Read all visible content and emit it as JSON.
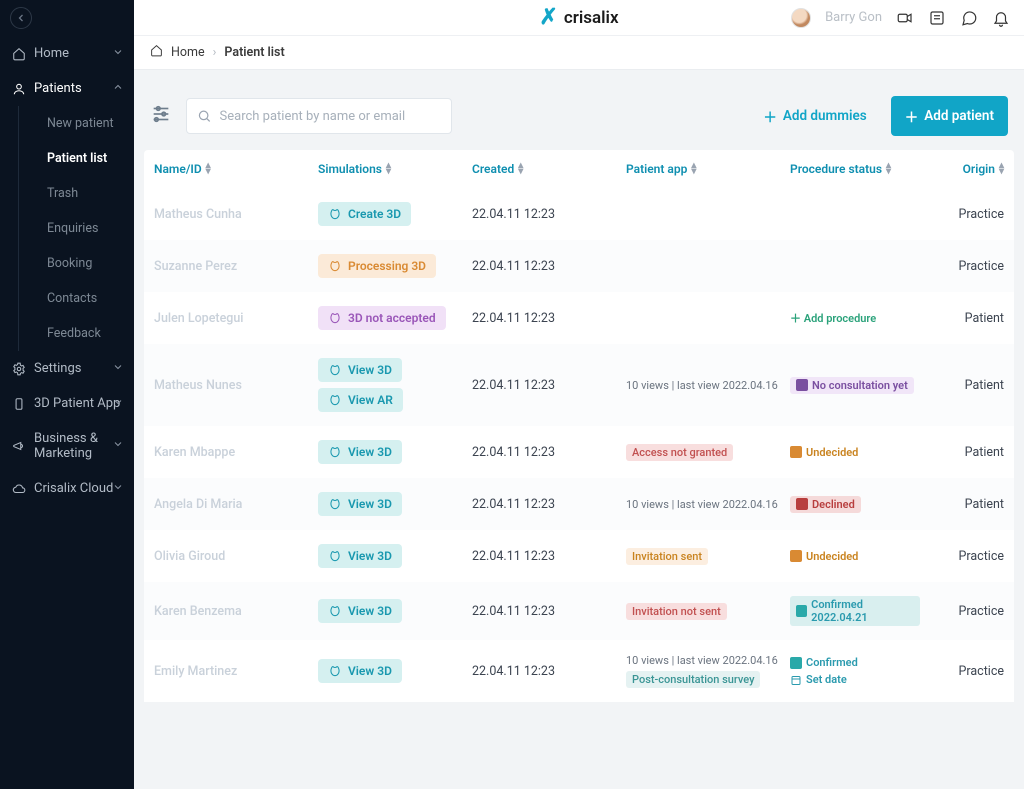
{
  "brand": "crisalix",
  "user": {
    "name": "Barry Gon"
  },
  "breadcrumb": {
    "home": "Home",
    "current": "Patient list"
  },
  "sidebar": {
    "home": "Home",
    "patients": "Patients",
    "sub": {
      "new_patient": "New patient",
      "patient_list": "Patient list",
      "trash": "Trash",
      "enquiries": "Enquiries",
      "booking": "Booking",
      "contacts": "Contacts",
      "feedback": "Feedback"
    },
    "settings": "Settings",
    "app3d": "3D Patient App",
    "business": "Business & Marketing",
    "cloud": "Crisalix Cloud"
  },
  "toolbar": {
    "search_placeholder": "Search patient by name or email",
    "add_dummies": "Add dummies",
    "add_patient": "Add patient"
  },
  "columns": {
    "name": "Name/ID",
    "simulations": "Simulations",
    "created": "Created",
    "patient_app": "Patient app",
    "procedure_status": "Procedure status",
    "origin": "Origin"
  },
  "labels": {
    "create_3d": "Create 3D",
    "processing_3d": "Processing 3D",
    "not_accepted": "3D not accepted",
    "view_3d": "View 3D",
    "view_ar": "View AR",
    "add_procedure": "Add procedure",
    "access_not_granted": "Access not granted",
    "invitation_sent": "Invitation sent",
    "invitation_not_sent": "Invitation not sent",
    "post_survey": "Post-consultation survey",
    "no_consult": "No consultation yet",
    "undecided": "Undecided",
    "declined": "Declined",
    "confirmed": "Confirmed",
    "set_date": "Set date"
  },
  "rows": [
    {
      "name": "Matheus Cunha",
      "sim": "create",
      "created": "22.04.11 12:23",
      "app": "",
      "status": "",
      "origin": "Practice"
    },
    {
      "name": "Suzanne Perez",
      "sim": "processing",
      "created": "22.04.11 12:23",
      "app": "",
      "status": "",
      "origin": "Practice"
    },
    {
      "name": "Julen Lopetegui",
      "sim": "notaccepted",
      "created": "22.04.11 12:23",
      "app": "",
      "status": "addproc",
      "origin": "Patient"
    },
    {
      "name": "Matheus Nunes",
      "sim": "view_ar",
      "created": "22.04.11 12:23",
      "app": "views",
      "status": "no_consult",
      "origin": "Patient",
      "views_text": "10 views | last view 2022.04.16"
    },
    {
      "name": "Karen Mbappe",
      "sim": "view",
      "created": "22.04.11 12:23",
      "app": "access_not",
      "status": "undecided",
      "origin": "Patient"
    },
    {
      "name": "Angela Di Maria",
      "sim": "view",
      "created": "22.04.11 12:23",
      "app": "views",
      "status": "declined",
      "origin": "Patient",
      "views_text": "10 views | last view 2022.04.16"
    },
    {
      "name": "Olivia Giroud",
      "sim": "view",
      "created": "22.04.11 12:23",
      "app": "inv_sent",
      "status": "undecided",
      "origin": "Practice"
    },
    {
      "name": "Karen Benzema",
      "sim": "view",
      "created": "22.04.11 12:23",
      "app": "inv_not",
      "status": "confirmed_date",
      "origin": "Practice",
      "confirmed_text": "Confirmed 2022.04.21"
    },
    {
      "name": "Emily Martinez",
      "sim": "view",
      "created": "22.04.11 12:23",
      "app": "views_survey",
      "status": "confirmed_setdate",
      "origin": "Practice",
      "views_text": "10 views | last view 2022.04.16"
    }
  ]
}
